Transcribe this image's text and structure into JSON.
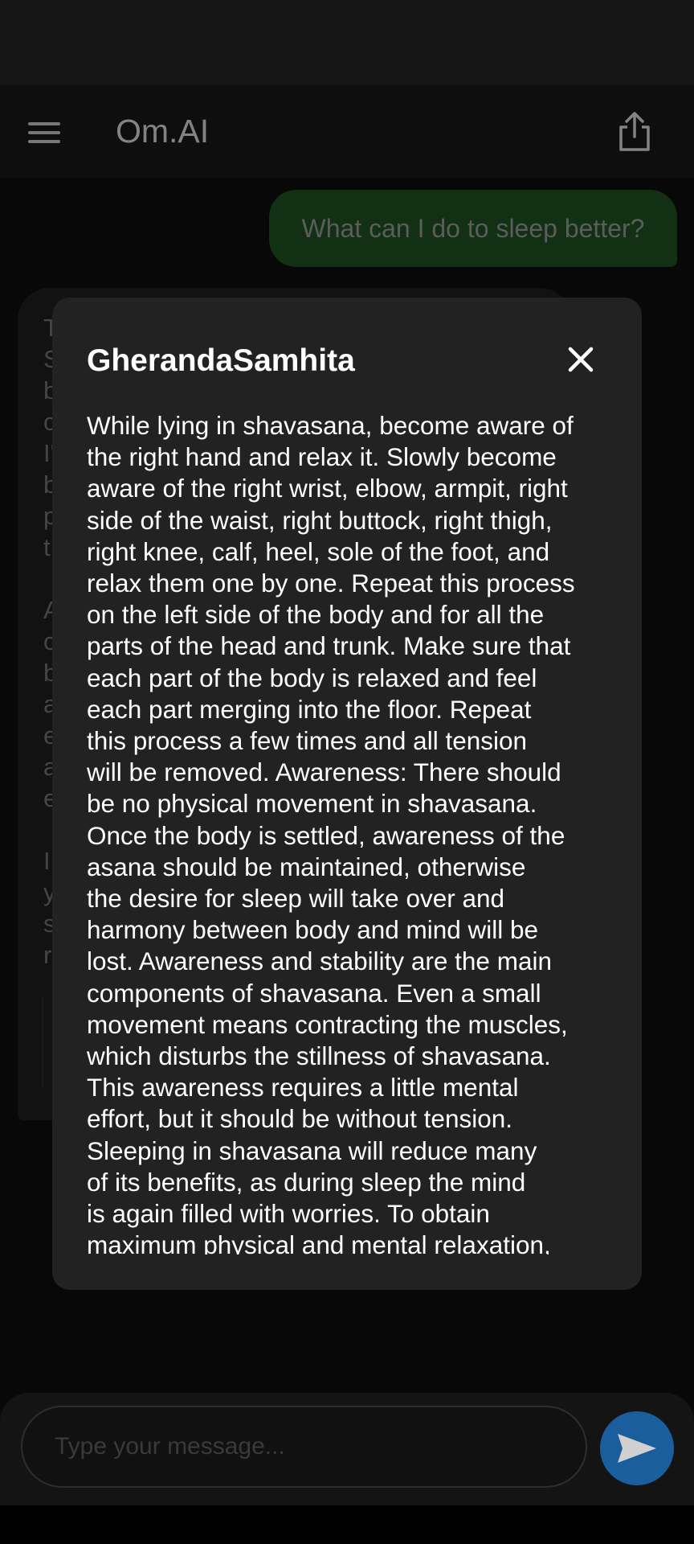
{
  "app": {
    "title": "Om.AI"
  },
  "chat": {
    "user_message": "What can I do to sleep better?",
    "bot_partial_letters": [
      "T",
      "S",
      "b",
      "c",
      "I'",
      "b",
      "p",
      "t",
      "",
      "A",
      "c",
      "b",
      "a",
      "e",
      "a",
      "e",
      "",
      "I",
      "y",
      "s",
      "r"
    ]
  },
  "modal": {
    "title": "GherandaSamhita",
    "lines": [
      "While lying in shavasana, become aware of",
      "the right hand and relax it. Slowly become",
      "aware of the right wrist, elbow, armpit, right",
      "side of the waist, right buttock, right thigh,",
      "right knee, calf, heel, sole of the foot, and",
      "relax them one by one. Repeat this process",
      "on the left side of the body and for all the",
      "parts of the head and trunk. Make sure that",
      "each part of the body is relaxed and feel",
      "each part merging into the floor. Repeat",
      "this process a few times and all tension",
      "will be removed. Awareness: There should",
      "be no physical movement in shavasana.",
      "Once the body is settled, awareness of the",
      "asana should be maintained, otherwise",
      "the desire for sleep will take over and",
      "harmony between body and mind will be",
      "lost. Awareness and stability are the main",
      "components of shavasana. Even a small",
      "movement means contracting the muscles,",
      "which disturbs the stillness of shavasana.",
      "This awareness requires a little mental",
      "effort, but it should be without tension.",
      "Sleeping in shavasana will reduce many",
      "of its benefits, as during sleep the mind",
      "is again filled with worries. To obtain",
      "maximum physical and mental relaxation,"
    ]
  },
  "composer": {
    "placeholder": "Type your message..."
  },
  "icons": {
    "menu": "menu-icon",
    "share": "share-icon",
    "close": "close-icon",
    "send": "send-icon"
  },
  "colors": {
    "user_bubble": "#1c4a1e",
    "send_button": "#1b5e9e",
    "modal_bg": "#222222"
  }
}
